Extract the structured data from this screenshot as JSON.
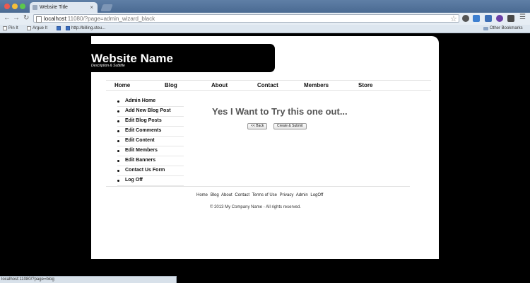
{
  "browser": {
    "tab_title": "Website Title",
    "tab_close": "×",
    "url_host": "localhost",
    "url_rest": ":11080/?page=admin_wizard_black",
    "bookmarks": [
      {
        "label": "Pin It",
        "icon": "page-icon"
      },
      {
        "label": "Argue It",
        "icon": "page-icon"
      },
      {
        "label": "",
        "icon": "w-icon"
      },
      {
        "label": "http://billing.steu...",
        "icon": "w-icon"
      }
    ],
    "other_bookmarks": "Other Bookmarks",
    "status_url": "localhost:11080/?page=blog"
  },
  "site": {
    "name": "Website Name",
    "description": "Description & Subtitle"
  },
  "nav": [
    "Home",
    "Blog",
    "About",
    "Contact",
    "Members",
    "Store"
  ],
  "sidebar": [
    "Admin Home",
    "Add New Blog Post",
    "Edit Blog Posts",
    "Edit Comments",
    "Edit Content",
    "Edit Members",
    "Edit Banners",
    "Contact Us Form",
    "Log Off"
  ],
  "main": {
    "heading": "Yes I Want to Try this one out...",
    "back_button": "<< Back",
    "submit_button": "Create & Submit"
  },
  "footer": {
    "links": [
      "Home",
      "Blog",
      "About",
      "Contact",
      "Terms of Use",
      "Privacy",
      "Admin",
      "LogOff"
    ],
    "copyright": "© 2013 My Company Name - All rights reserved."
  }
}
